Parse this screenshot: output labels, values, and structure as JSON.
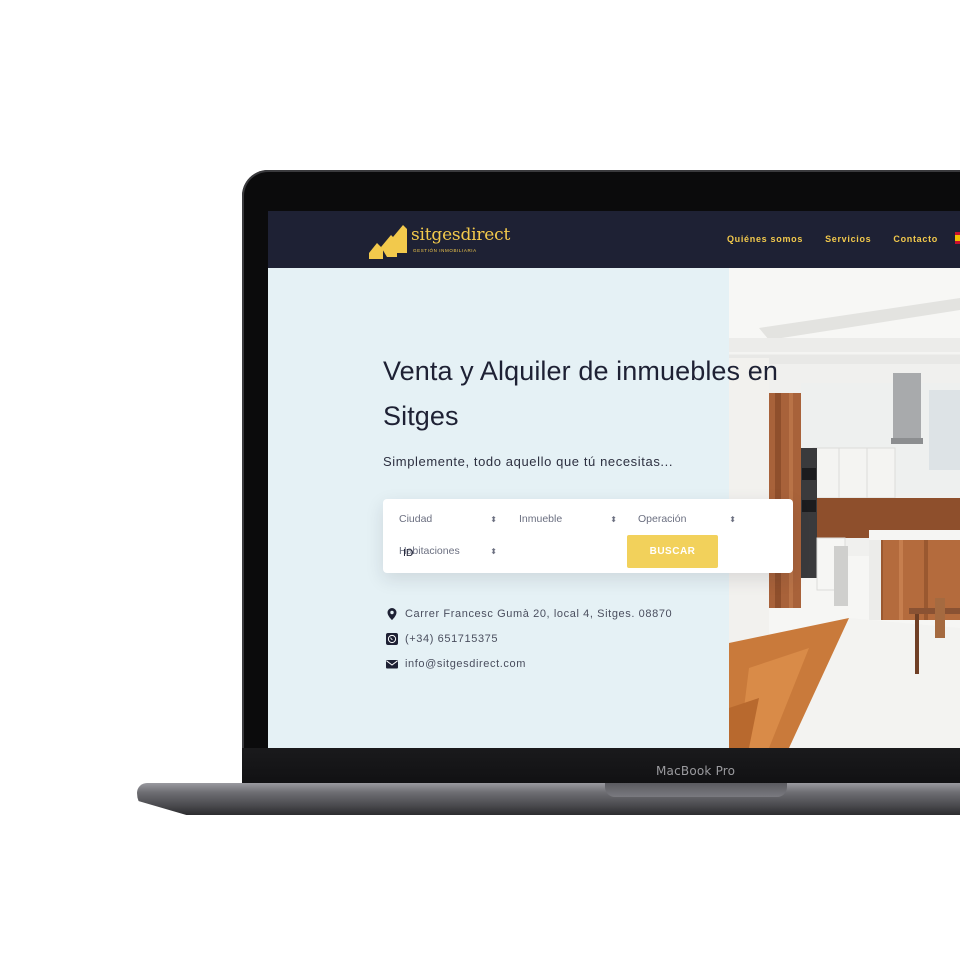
{
  "device": {
    "label": "MacBook Pro"
  },
  "header": {
    "logo": {
      "name": "sitgesdirect",
      "tagline": "GESTIÓN INMOBILIARIA"
    },
    "nav": [
      "Quiénes somos",
      "Servicios",
      "Contacto"
    ]
  },
  "hero": {
    "title_line1": "Venta y Alquiler de inmuebles en",
    "title_line2": "Sitges",
    "subtitle": "Simplemente, todo aquello que tú necesitas..."
  },
  "search": {
    "ciudad": "Ciudad",
    "inmueble": "Inmueble",
    "operacion": "Operación",
    "habitaciones": "Habitaciones",
    "id_placeholder": "ID",
    "button": "BUSCAR"
  },
  "contact": {
    "address": "Carrer Francesc Gumà 20, local 4, Sitges. 08870",
    "phone": "(+34) 651715375",
    "email": "info@sitgesdirect.com"
  },
  "colors": {
    "navy": "#1e2134",
    "accent": "#f2c94c",
    "hero_bg": "#e5f1f5",
    "button": "#f2d15b"
  }
}
